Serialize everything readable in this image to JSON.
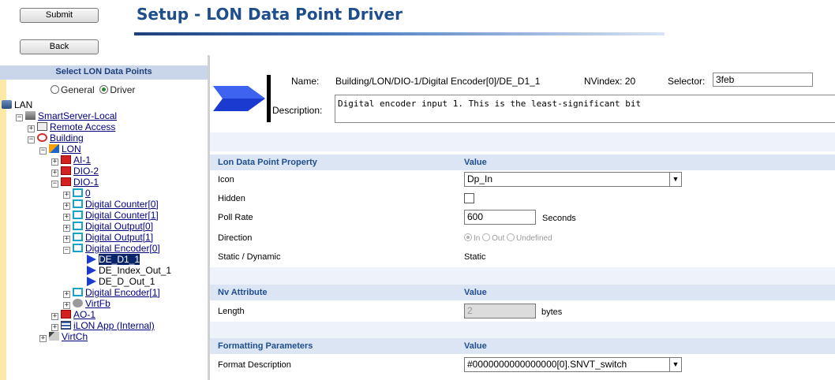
{
  "toolbar": {
    "submit_label": "Submit",
    "back_label": "Back"
  },
  "page": {
    "title": "Setup - LON Data Point Driver"
  },
  "tree": {
    "header": "Select LON Data Points",
    "mode_general": "General",
    "mode_driver": "Driver",
    "nodes": {
      "lan": "LAN",
      "smartserver": "SmartServer-Local",
      "remote_access": "Remote Access",
      "building": "Building",
      "lon": "LON",
      "ai1": "AI-1",
      "dio2": "DIO-2",
      "dio1": "DIO-1",
      "zero": "0",
      "dc0": "Digital Counter[0]",
      "dc1": "Digital Counter[1]",
      "do0": "Digital Output[0]",
      "do1": "Digital Output[1]",
      "de0": "Digital Encoder[0]",
      "de_d1_1": "DE_D1_1",
      "de_index_out_1": "DE_Index_Out_1",
      "de_d_out_1": "DE_D_Out_1",
      "de1": "Digital Encoder[1]",
      "virtfb": "VirtFb",
      "ao1": "AO-1",
      "ilon_app": "iLON App (Internal)",
      "virtch": "VirtCh"
    }
  },
  "info": {
    "name_label": "Name:",
    "name_value": "Building/LON/DIO-1/Digital Encoder[0]/DE_D1_1",
    "nvindex_label": "NVindex: 20",
    "selector_label": "Selector:",
    "selector_value": "3feb",
    "description_label": "Description:",
    "description_value": "Digital encoder input 1. This is the least-significant bit"
  },
  "lon_properties": {
    "header_property": "Lon Data Point Property",
    "header_value": "Value",
    "icon_label": "Icon",
    "icon_value": "Dp_In",
    "hidden_label": "Hidden",
    "hidden_checked": false,
    "poll_rate_label": "Poll Rate",
    "poll_rate_value": "600",
    "poll_rate_unit": "Seconds",
    "direction_label": "Direction",
    "direction_options": [
      "In",
      "Out",
      "Undefined"
    ],
    "direction_selected": "In",
    "static_dynamic_label": "Static / Dynamic",
    "static_dynamic_value": "Static"
  },
  "nv_attribute": {
    "header_property": "Nv Attribute",
    "header_value": "Value",
    "length_label": "Length",
    "length_value": "2",
    "length_unit": "bytes"
  },
  "formatting": {
    "header_property": "Formatting Parameters",
    "header_value": "Value",
    "format_description_label": "Format Description",
    "format_description_value": "#0000000000000000[0].SNVT_switch"
  },
  "colors": {
    "title": "#1f4e8c",
    "section_header_bg": "#dbe5f3",
    "tree_selection": "#0a246a",
    "sidebar_stripe": "#fde9a7"
  }
}
